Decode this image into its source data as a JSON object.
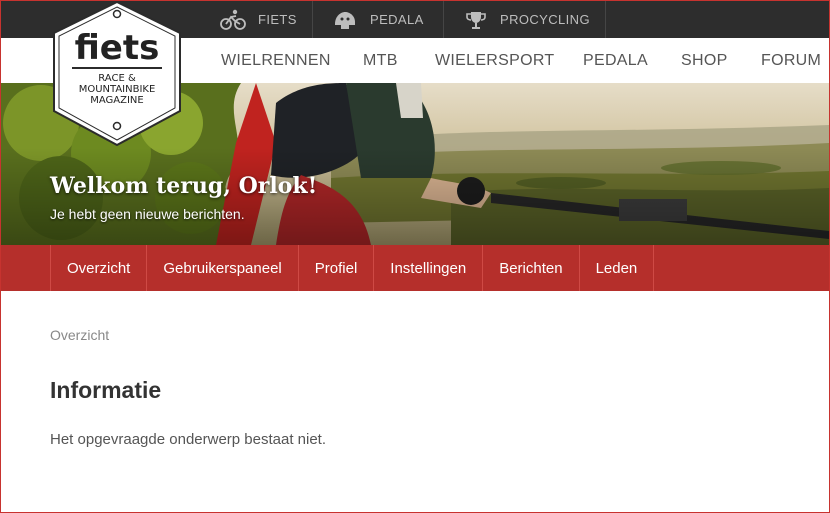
{
  "topbar": {
    "items": [
      {
        "label": "FIETS",
        "icon": "cyclist-icon"
      },
      {
        "label": "PEDALA",
        "icon": "helmet-icon"
      },
      {
        "label": "PROCYCLING",
        "icon": "cup-icon"
      }
    ]
  },
  "logo": {
    "title": "fiets",
    "line1": "RACE &",
    "line2": "MOUNTAINBIKE",
    "line3": "MAGAZINE"
  },
  "mainnav": {
    "items": [
      "WIELRENNEN",
      "MTB",
      "WIELERSPORT",
      "PEDALA",
      "SHOP",
      "FORUM"
    ]
  },
  "hero": {
    "title": "Welkom terug, Orlok!",
    "subtitle": "Je hebt geen nieuwe berichten."
  },
  "tabs": [
    "Overzicht",
    "Gebruikerspaneel",
    "Profiel",
    "Instellingen",
    "Berichten",
    "Leden"
  ],
  "content": {
    "breadcrumb": "Overzicht",
    "title": "Informatie",
    "message": "Het opgevraagde onderwerp bestaat niet."
  },
  "colors": {
    "accent": "#b52f2b",
    "topbar": "#2d2d2d"
  }
}
